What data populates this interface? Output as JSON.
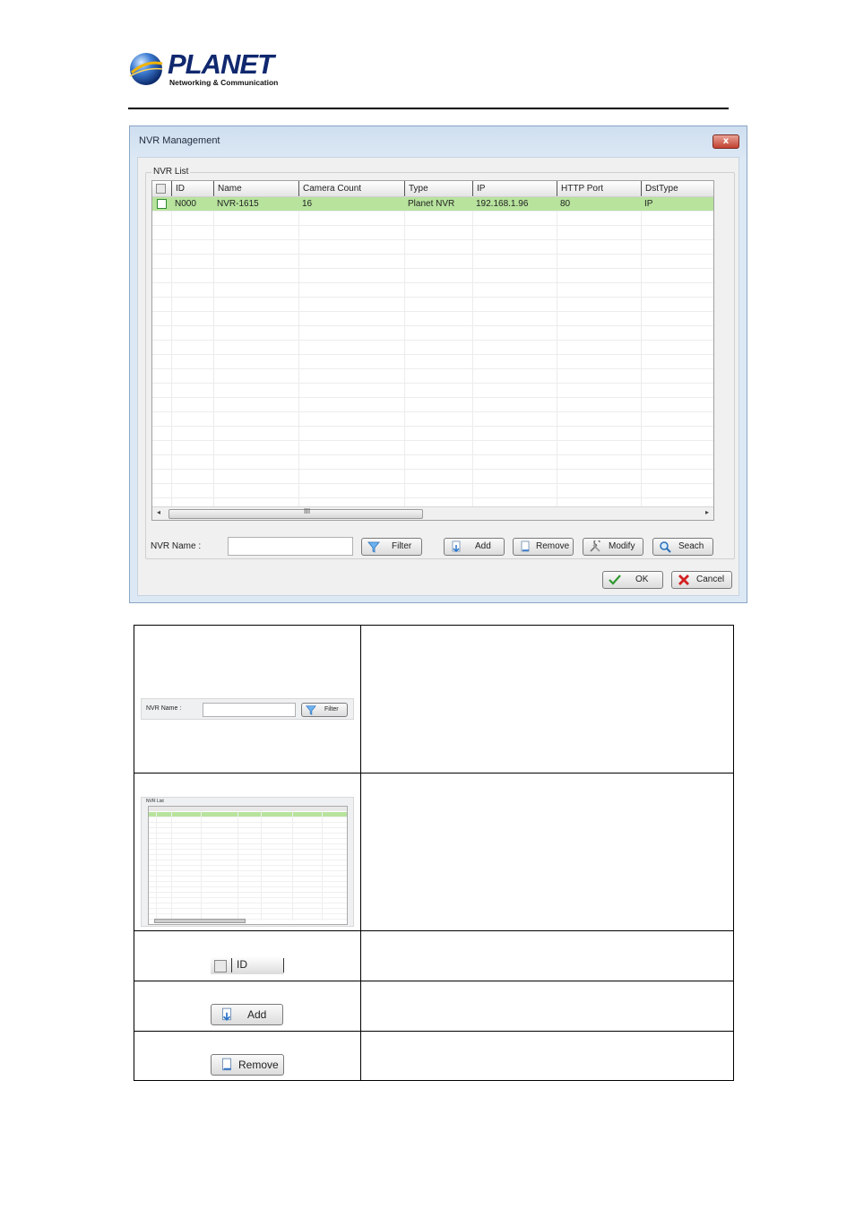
{
  "logo": {
    "brand": "PLANET",
    "tagline": "Networking & Communication"
  },
  "dialog": {
    "title": "NVR Management",
    "close_label": "x",
    "group_label": "NVR List",
    "columns": [
      "ID",
      "Name",
      "Camera Count",
      "Type",
      "IP",
      "HTTP Port",
      "DstType"
    ],
    "rows": [
      {
        "id": "N000",
        "name": "NVR-1615",
        "camera_count": "16",
        "type": "Planet NVR",
        "ip": "192.168.1.96",
        "http_port": "80",
        "dst_type": "IP"
      }
    ],
    "scroll_grip": "III",
    "nvr_name_label": "NVR Name :",
    "nvr_name_value": "",
    "buttons": {
      "filter": "Filter",
      "add": "Add",
      "remove": "Remove",
      "modify": "Modify",
      "search": "Seach",
      "ok": "OK",
      "cancel": "Cancel"
    }
  },
  "colors": {
    "selected_row": "#b7e39d",
    "logo_blue": "#10286e"
  },
  "description_table": {
    "items": [
      {
        "kind": "nvr-name-filter",
        "label": "NVR Name :",
        "button": "Filter"
      },
      {
        "kind": "nvr-list-thumbnail",
        "label": "NVR List"
      },
      {
        "kind": "id-header",
        "label": "ID"
      },
      {
        "kind": "add-button",
        "label": "Add"
      },
      {
        "kind": "remove-button",
        "label": "Remove"
      }
    ]
  }
}
